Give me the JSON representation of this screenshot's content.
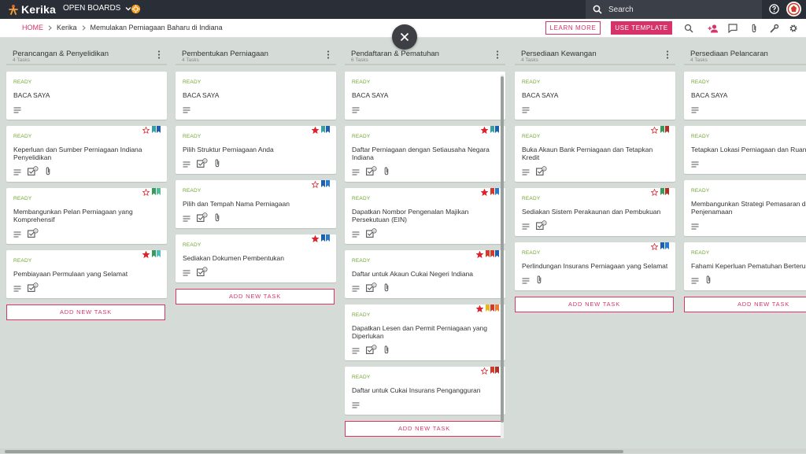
{
  "nav": {
    "logo": "Kerika",
    "open_boards": "OPEN BOARDS",
    "search_placeholder": "Search"
  },
  "breadcrumb": {
    "home": "HOME",
    "section": "Kerika",
    "board": "Memulakan Perniagaan Baharu di Indiana"
  },
  "actions": {
    "learn_more": "LEARN MORE",
    "use_template": "USE TEMPLATE"
  },
  "colors": {
    "accent": "#d5366a",
    "status_ready": "#6ea52d",
    "nav_bg": "#2a2e36",
    "board_bg": "#d5dcd8"
  },
  "icons": {
    "tools": [
      "search-icon",
      "add-person-icon",
      "chat-icon",
      "attachment-icon",
      "tools-icon",
      "gear-icon"
    ],
    "card": [
      "description-icon",
      "checklist-icon",
      "attachment-icon"
    ]
  },
  "columns": [
    {
      "title": "Perancangan & Penyelidikan",
      "count": "4 Tasks",
      "add_label": "ADD NEW TASK",
      "cards": [
        {
          "status": "READY",
          "title": "BACA SAYA",
          "flags": [],
          "icons": [
            "desc"
          ]
        },
        {
          "status": "READY",
          "title": "Keperluan dan Sumber Perniagaan Indiana Penyelidikan",
          "flags": [
            "star-outline",
            "#3aa0a0",
            "#1f5fb0"
          ],
          "icons": [
            "desc",
            "check",
            "clip"
          ]
        },
        {
          "status": "READY",
          "title": "Membangunkan Pelan Perniagaan yang Komprehensif",
          "flags": [
            "star-outline",
            "#3a9a5a",
            "#4fbf9a"
          ],
          "icons": [
            "desc",
            "check"
          ]
        },
        {
          "status": "READY",
          "title": "Pembiayaan Permulaan yang Selamat",
          "flags": [
            "star-filled",
            "#3a9a5a",
            "#4fbfc0"
          ],
          "icons": [
            "desc",
            "check"
          ]
        }
      ]
    },
    {
      "title": "Pembentukan Perniagaan",
      "count": "4 Tasks",
      "add_label": "ADD NEW TASK",
      "cards": [
        {
          "status": "READY",
          "title": "BACA SAYA",
          "flags": [],
          "icons": [
            "desc"
          ]
        },
        {
          "status": "READY",
          "title": "Pilih Struktur Perniagaan Anda",
          "flags": [
            "star-filled",
            "#3aa0a0",
            "#1f5fb0"
          ],
          "icons": [
            "desc",
            "check",
            "clip"
          ]
        },
        {
          "status": "READY",
          "title": "Pilih dan Tempah Nama Perniagaan",
          "flags": [
            "star-outline",
            "#1f5fb0",
            "#2a7acb"
          ],
          "icons": [
            "desc",
            "check",
            "clip"
          ]
        },
        {
          "status": "READY",
          "title": "Sediakan Dokumen Pembentukan",
          "flags": [
            "star-filled",
            "#1f5fb0",
            "#2a7acb"
          ],
          "icons": [
            "desc",
            "check"
          ]
        }
      ]
    },
    {
      "title": "Pendaftaran & Pematuhan",
      "count": "6 Tasks",
      "add_label": "ADD NEW TASK",
      "cards": [
        {
          "status": "READY",
          "title": "BACA SAYA",
          "flags": [],
          "icons": [
            "desc"
          ]
        },
        {
          "status": "READY",
          "title": "Daftar Perniagaan dengan Setiausaha Negara Indiana",
          "flags": [
            "star-filled",
            "#3aa0a0",
            "#1f5fb0"
          ],
          "icons": [
            "desc",
            "check",
            "clip"
          ]
        },
        {
          "status": "READY",
          "title": "Dapatkan Nombor Pengenalan Majikan Persekutuan (EIN)",
          "flags": [
            "star-filled",
            "#d23a2a",
            "#2a7acb"
          ],
          "icons": [
            "desc",
            "check"
          ]
        },
        {
          "status": "READY",
          "title": "Daftar untuk Akaun Cukai Negeri Indiana",
          "flags": [
            "star-filled",
            "#d23a2a",
            "#d23a2a",
            "#1f5fb0"
          ],
          "icons": [
            "desc",
            "check",
            "clip"
          ]
        },
        {
          "status": "READY",
          "title": "Dapatkan Lesen dan Permit Perniagaan yang Diperlukan",
          "flags": [
            "star-filled",
            "#e8b420",
            "#d23a2a",
            "#ef7a30"
          ],
          "icons": [
            "desc",
            "check",
            "clip"
          ]
        },
        {
          "status": "READY",
          "title": "Daftar untuk Cukai Insurans Pengangguran",
          "flags": [
            "star-outline",
            "#d23a2a",
            "#b0302a"
          ],
          "icons": [
            "desc"
          ]
        }
      ]
    },
    {
      "title": "Persediaan Kewangan",
      "count": "4 Tasks",
      "add_label": "ADD NEW TASK",
      "cards": [
        {
          "status": "READY",
          "title": "BACA SAYA",
          "flags": [],
          "icons": [
            "desc"
          ]
        },
        {
          "status": "READY",
          "title": "Buka Akaun Bank Perniagaan dan Tetapkan Kredit",
          "flags": [
            "star-outline",
            "#3a9a5a",
            "#b0302a"
          ],
          "icons": [
            "desc",
            "check"
          ]
        },
        {
          "status": "READY",
          "title": "Sediakan Sistem Perakaunan dan Pembukuan",
          "flags": [
            "star-outline",
            "#3a9a5a",
            "#b0302a"
          ],
          "icons": [
            "desc",
            "check"
          ]
        },
        {
          "status": "READY",
          "title": "Perlindungan Insurans Perniagaan yang Selamat",
          "flags": [
            "star-outline",
            "#1f5fb0",
            "#2a7acb"
          ],
          "icons": [
            "desc",
            "clip"
          ]
        }
      ]
    },
    {
      "title": "Persediaan Pelancaran",
      "count": "4 Tasks",
      "add_label": "ADD NEW TASK",
      "cards": [
        {
          "status": "READY",
          "title": "BACA SAYA",
          "flags": [],
          "icons": [
            "desc"
          ]
        },
        {
          "status": "READY",
          "title": "Tetapkan Lokasi Perniagaan dan Ruang",
          "flags": [],
          "icons": [
            "desc"
          ]
        },
        {
          "status": "READY",
          "title": "Membangunkan Strategi Pemasaran dan Penjenamaan",
          "flags": [],
          "icons": [
            "desc"
          ]
        },
        {
          "status": "READY",
          "title": "Fahami Keperluan Pematuhan Berterusan",
          "flags": [],
          "icons": [
            "desc",
            "clip"
          ]
        }
      ]
    }
  ]
}
